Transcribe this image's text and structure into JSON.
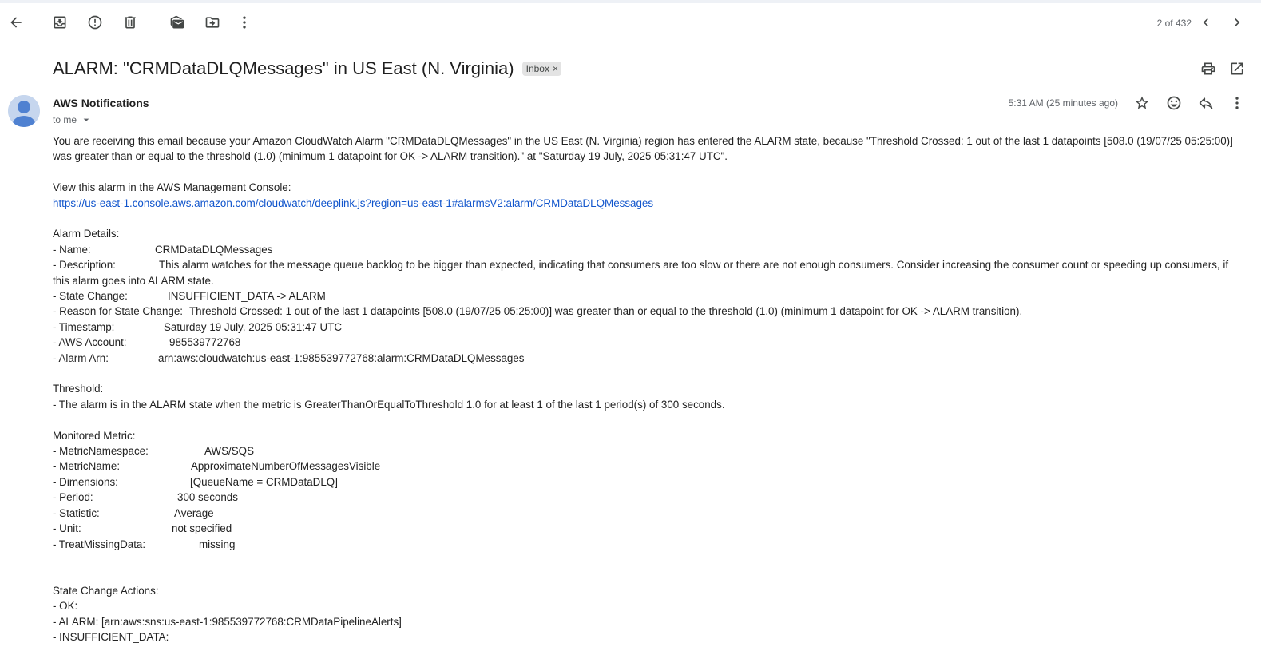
{
  "toolbar": {
    "back_icon": "arrow-left-icon",
    "archive_icon": "archive-icon",
    "report_spam_icon": "report-icon",
    "delete_icon": "trash-icon",
    "mark_unread_icon": "mark-unread-icon",
    "move_to_icon": "move-to-folder-icon",
    "more_icon": "more-vert-icon",
    "pager_text": "2 of 432",
    "prev_icon": "chevron-left-icon",
    "next_icon": "chevron-right-icon"
  },
  "subject": {
    "title": "ALARM: \"CRMDataDLQMessages\" in US East (N. Virginia)",
    "label": "Inbox",
    "label_remove": "×",
    "print_icon": "print-icon",
    "new_window_icon": "open-in-new-icon"
  },
  "header": {
    "sender": "AWS Notifications",
    "recipient": "to me",
    "time": "5:31 AM (25 minutes ago)",
    "star_icon": "star-icon",
    "emoji_icon": "emoji-icon",
    "reply_icon": "reply-icon",
    "more_icon": "more-vert-icon"
  },
  "email": {
    "intro": "You are receiving this email because your Amazon CloudWatch Alarm \"CRMDataDLQMessages\" in the US East (N. Virginia) region has entered the ALARM state, because \"Threshold Crossed: 1 out of the last 1 datapoints [508.0 (19/07/25 05:25:00)] was greater than or equal to the threshold (1.0) (minimum 1 datapoint for OK -> ALARM transition).\" at \"Saturday 19 July, 2025 05:31:47 UTC\".",
    "console_label": "View this alarm in the AWS Management Console:",
    "console_link": "https://us-east-1.console.aws.amazon.com/cloudwatch/deeplink.js?region=us-east-1#alarmsV2:alarm/CRMDataDLQMessages",
    "alarm_details_heading": "Alarm Details:",
    "alarm_details": [
      {
        "key": "- Name:",
        "value": "CRMDataDLQMessages"
      },
      {
        "key": "- Description:",
        "value": "This alarm watches for the message queue backlog to be bigger than expected, indicating that consumers are too slow or there are not enough consumers. Consider increasing the consumer count or speeding up consumers, if this alarm goes into ALARM state."
      },
      {
        "key": "- State Change:",
        "value": "INSUFFICIENT_DATA -> ALARM"
      },
      {
        "key": "- Reason for State Change:",
        "value": "Threshold Crossed: 1 out of the last 1 datapoints [508.0 (19/07/25 05:25:00)] was greater than or equal to the threshold (1.0) (minimum 1 datapoint for OK -> ALARM transition)."
      },
      {
        "key": "- Timestamp:",
        "value": "Saturday 19 July, 2025 05:31:47 UTC"
      },
      {
        "key": "- AWS Account:",
        "value": "985539772768"
      },
      {
        "key": "- Alarm Arn:",
        "value": "arn:aws:cloudwatch:us-east-1:985539772768:alarm:CRMDataDLQMessages"
      }
    ],
    "threshold_heading": "Threshold:",
    "threshold_text": "- The alarm is in the ALARM state when the metric is GreaterThanOrEqualToThreshold 1.0 for at least 1 of the last 1 period(s) of 300 seconds.",
    "metric_heading": "Monitored Metric:",
    "metric_details": [
      {
        "key": "- MetricNamespace:",
        "value": "AWS/SQS"
      },
      {
        "key": "- MetricName:",
        "value": "ApproximateNumberOfMessagesVisible"
      },
      {
        "key": "- Dimensions:",
        "value": "[QueueName = CRMDataDLQ]"
      },
      {
        "key": "- Period:",
        "value": "300 seconds"
      },
      {
        "key": "- Statistic:",
        "value": "Average"
      },
      {
        "key": "- Unit:",
        "value": "not specified"
      },
      {
        "key": "- TreatMissingData:",
        "value": "missing"
      }
    ],
    "actions_heading": "State Change Actions:",
    "actions": [
      "- OK:",
      "- ALARM: [arn:aws:sns:us-east-1:985539772768:CRMDataPipelineAlerts]",
      "- INSUFFICIENT_DATA:"
    ]
  }
}
